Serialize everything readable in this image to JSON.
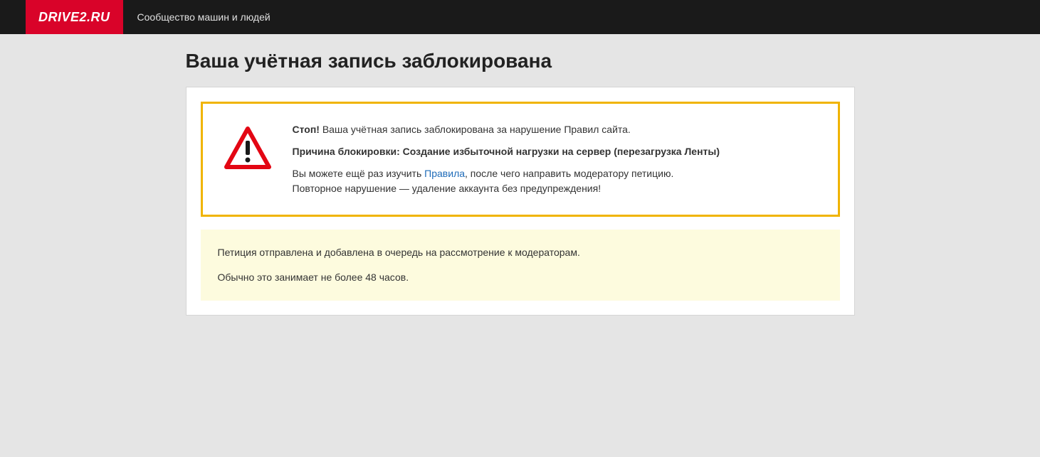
{
  "header": {
    "logo_text": "DRIVE2.RU",
    "tagline": "Сообщество машин и людей"
  },
  "page": {
    "title": "Ваша учётная запись заблокирована"
  },
  "warning": {
    "stop_label": "Стоп!",
    "stop_text": " Ваша учётная запись заблокирована за нарушение Правил сайта.",
    "reason_label": "Причина блокировки: Создание избыточной нагрузки на сервер (перезагрузка Ленты)",
    "rules_pre": "Вы можете ещё раз изучить ",
    "rules_link": "Правила",
    "rules_post": ", после чего направить модератору петицию.",
    "repeat_warning": "Повторное нарушение — удаление аккаунта без предупреждения!"
  },
  "petition": {
    "sent_text": "Петиция отправлена и добавлена в очередь на рассмотрение к модераторам.",
    "time_text": "Обычно это занимает не более 48 часов."
  }
}
